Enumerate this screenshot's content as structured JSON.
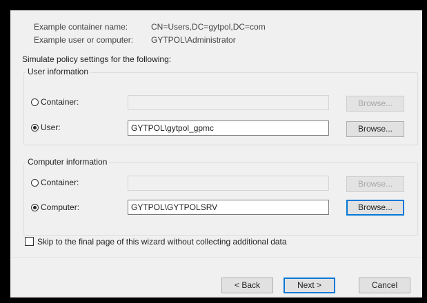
{
  "examples": {
    "container_label": "Example container name:",
    "container_value": "CN=Users,DC=gytpol,DC=com",
    "user_label": "Example user or computer:",
    "user_value": "GYTPOL\\Administrator"
  },
  "simulate_heading": "Simulate policy settings for the following:",
  "user_info": {
    "title": "User information",
    "container_label": "Container:",
    "container_value": "",
    "container_browse": "Browse...",
    "user_label": "User:",
    "user_value": "GYTPOL\\gytpol_gpmc",
    "user_browse": "Browse...",
    "selected": "user"
  },
  "computer_info": {
    "title": "Computer information",
    "container_label": "Container:",
    "container_value": "",
    "container_browse": "Browse...",
    "computer_label": "Computer:",
    "computer_value": "GYTPOL\\GYTPOLSRV",
    "computer_browse": "Browse...",
    "selected": "computer"
  },
  "skip_checkbox": {
    "label": "Skip to the final page of this wizard without collecting additional data",
    "checked": false
  },
  "footer": {
    "back": "< Back",
    "next": "Next >",
    "cancel": "Cancel"
  }
}
